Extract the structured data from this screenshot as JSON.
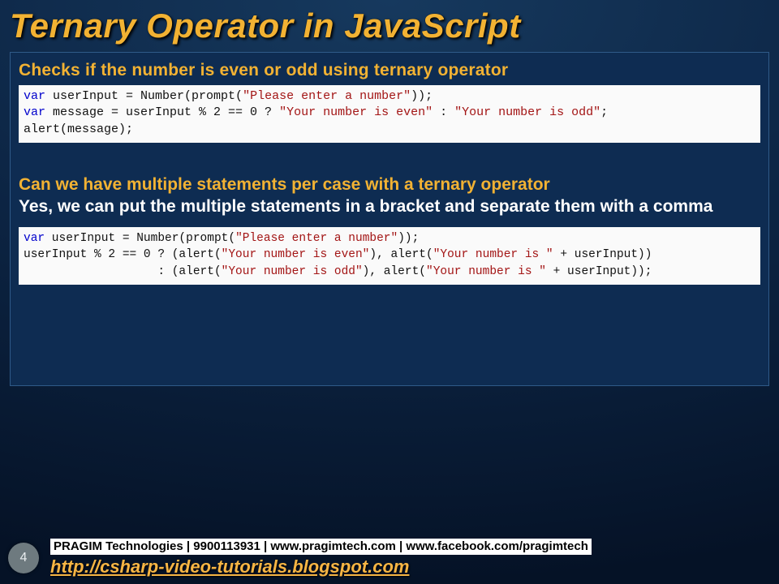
{
  "title": "Ternary Operator in JavaScript",
  "section1": {
    "heading": "Checks if the number is even or odd using ternary operator"
  },
  "code1": {
    "t01": "var",
    "t02": " userInput = Number(prompt(",
    "t03": "\"Please enter a number\"",
    "t04": "));",
    "t05": "var",
    "t06": " message = userInput % 2 == 0 ? ",
    "t07": "\"Your number is even\"",
    "t08": " : ",
    "t09": "\"Your number is odd\"",
    "t10": ";",
    "t11": "alert(message);"
  },
  "section2": {
    "heading": "Can we have multiple statements per case with a ternary operator",
    "answer": "Yes, we can put the multiple statements in a bracket and separate them with a comma"
  },
  "code2": {
    "t01": "var",
    "t02": " userInput = Number(prompt(",
    "t03": "\"Please enter a number\"",
    "t04": "));",
    "t05": "userInput % 2 == 0 ? (alert(",
    "t06": "\"Your number is even\"",
    "t07": "), alert(",
    "t08": "\"Your number is \"",
    "t09": " + userInput))",
    "t10": "                   : (alert(",
    "t11": "\"Your number is odd\"",
    "t12": "), alert(",
    "t13": "\"Your number is \"",
    "t14": " + userInput));"
  },
  "footer": {
    "page": "4",
    "line1": "PRAGIM Technologies | 9900113931 | www.pragimtech.com | www.facebook.com/pragimtech",
    "link": "http://csharp-video-tutorials.blogspot.com"
  }
}
